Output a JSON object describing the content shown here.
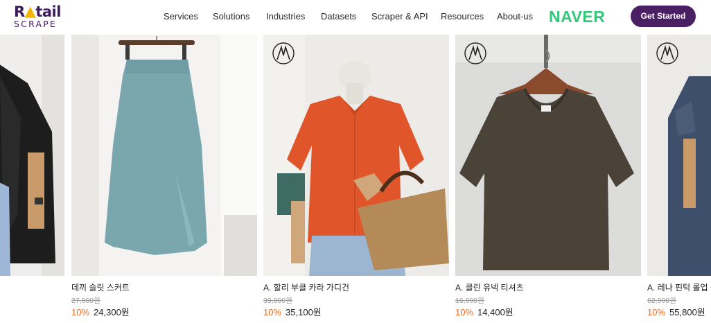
{
  "logo": {
    "line1_a": "R",
    "line1_b": "tail",
    "line2": "SCRAPE"
  },
  "nav": {
    "items": [
      "Services",
      "Solutions",
      "Industries",
      "Datasets",
      "Scraper & API",
      "Resources",
      "About-us"
    ]
  },
  "partner_logo": "NAVER",
  "cta_label": "Get Started",
  "products": [
    {
      "name": "데끼 슬릿 스커트",
      "original_price": "27,000원",
      "discount": "10%",
      "price": "24,300원"
    },
    {
      "name": "A. 할리 부클 카라 가디건",
      "original_price": "39,000원",
      "discount": "10%",
      "price": "35,100원"
    },
    {
      "name": "A. 클린 유넥 티셔츠",
      "original_price": "16,000원",
      "discount": "10%",
      "price": "14,400원"
    },
    {
      "name": "A. 레나 핀턱 롤업 원",
      "original_price": "62,000원",
      "discount": "10%",
      "price": "55,800원"
    }
  ],
  "colors": {
    "brand_purple": "#4a1f63",
    "naver_green": "#34c77b",
    "discount_orange": "#f26b21"
  },
  "icons": [
    "bolt-icon",
    "brand-monogram-icon"
  ]
}
